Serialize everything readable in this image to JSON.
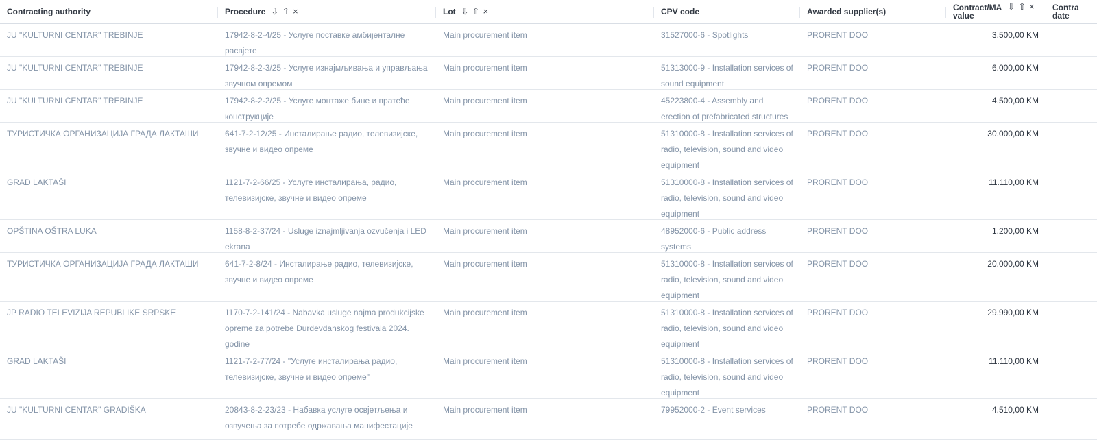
{
  "headers": {
    "contracting_authority": "Contracting authority",
    "procedure": "Procedure",
    "lot": "Lot",
    "cpv_code": "CPV code",
    "awarded_suppliers": "Awarded supplier(s)",
    "contract_value_line1": "Contract/MA",
    "contract_value_line2": "value",
    "contract_date_line1": "Contra",
    "contract_date_line2": "date",
    "sort_desc_glyph": "⇩",
    "sort_asc_glyph": "⇧",
    "remove_glyph": "×"
  },
  "rows": [
    {
      "authority": "JU \"KULTURNI CENTAR\" TREBINJE",
      "procedure": "17942-8-2-4/25 - Услуге поставке амбијенталне расвјете",
      "lot": "Main procurement item",
      "cpv": "31527000-6 - Spotlights",
      "supplier": "PRORENT DOO",
      "value": "3.500,00 KM",
      "h": 48
    },
    {
      "authority": "JU \"KULTURNI CENTAR\" TREBINJE",
      "procedure": "17942-8-2-3/25 - Услуге изнајмљивања и управљања звучном опремом",
      "lot": "Main procurement item",
      "cpv": "51313000-9 - Installation services of sound equipment",
      "supplier": "PRORENT DOO",
      "value": "6.000,00 KM",
      "h": 48
    },
    {
      "authority": "JU \"KULTURNI CENTAR\" TREBINJE",
      "procedure": "17942-8-2-2/25 - Услуге монтаже бине и пратеће конструкције",
      "lot": "Main procurement item",
      "cpv": "45223800-4 - Assembly and erection of prefabricated structures",
      "supplier": "PRORENT DOO",
      "value": "4.500,00 KM",
      "h": 48
    },
    {
      "authority": "ТУРИСТИЧКА ОРГАНИЗАЦИЈА ГРАДА ЛАКТАШИ",
      "procedure": "641-7-2-12/25 - Инсталирање радио, телевизијске, звучне и видео опреме",
      "lot": "Main procurement item",
      "cpv": "51310000-8 - Installation services of radio, television, sound and video equipment",
      "supplier": "PRORENT DOO",
      "value": "30.000,00 KM",
      "h": 71
    },
    {
      "authority": "GRAD LAKTAŠI",
      "procedure": "1121-7-2-66/25 - Услуге инсталирања, радио, телевизијске, звучне и видео опреме",
      "lot": "Main procurement item",
      "cpv": "51310000-8 - Installation services of radio, television, sound and video equipment",
      "supplier": "PRORENT DOO",
      "value": "11.110,00 KM",
      "h": 71
    },
    {
      "authority": "OPŠTINA OŠTRA LUKA",
      "procedure": "1158-8-2-37/24 - Usluge iznajmljivanja ozvučenja i LED ekrana",
      "lot": "Main procurement item",
      "cpv": "48952000-6 - Public address systems",
      "supplier": "PRORENT DOO",
      "value": "1.200,00 KM",
      "h": 48
    },
    {
      "authority": "ТУРИСТИЧКА ОРГАНИЗАЦИЈА ГРАДА ЛАКТАШИ",
      "procedure": "641-7-2-8/24 - Инсталирање радио, телевизијске, звучне и видео опреме",
      "lot": "Main procurement item",
      "cpv": "51310000-8 - Installation services of radio, television, sound and video equipment",
      "supplier": "PRORENT DOO",
      "value": "20.000,00 KM",
      "h": 71
    },
    {
      "authority": "JP RADIO TELEVIZIJA REPUBLIKE SRPSKE",
      "procedure": "1170-7-2-141/24 - Nabavka usluge najma produkcijske opreme za potrebe Đurđevdanskog festivala 2024. godine",
      "lot": "Main procurement item",
      "cpv": "51310000-8 - Installation services of radio, television, sound and video equipment",
      "supplier": "PRORENT DOO",
      "value": "29.990,00 KM",
      "h": 71
    },
    {
      "authority": "GRAD LAKTAŠI",
      "procedure": "1121-7-2-77/24 - \"Услуге инсталирања радио, телевизијске, звучне и видео опреме\"",
      "lot": "Main procurement item",
      "cpv": "51310000-8 - Installation services of radio, television, sound and video equipment",
      "supplier": "PRORENT DOO",
      "value": "11.110,00 KM",
      "h": 71
    },
    {
      "authority": "JU \"KULTURNI CENTAR\" GRADIŠKA",
      "procedure": "20843-8-2-23/23 - Набавка услуге освјетљења и озвучења за потребе одржавања манифестације",
      "lot": "Main procurement item",
      "cpv": "79952000-2 - Event services",
      "supplier": "PRORENT DOO",
      "value": "4.510,00 KM",
      "h": 60
    }
  ]
}
